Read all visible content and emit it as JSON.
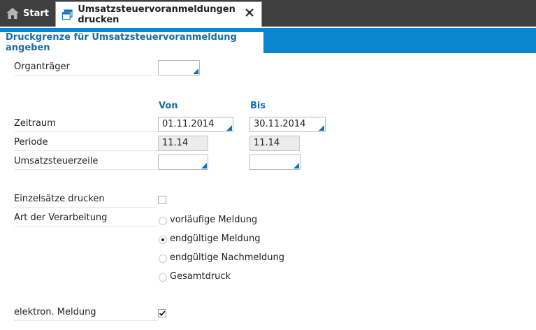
{
  "tabs": {
    "start_label": "Start",
    "active_label": "Umsatzsteuervoranmeldungen drucken"
  },
  "section": {
    "title": "Druckgrenze für Umsatzsteuervoranmeldung angeben"
  },
  "columns": {
    "from": "Von",
    "to": "Bis"
  },
  "fields": {
    "organtraeger": {
      "label": "Organträger",
      "value": ""
    },
    "zeitraum": {
      "label": "Zeitraum",
      "from": "01.11.2014",
      "to": "30.11.2014"
    },
    "periode": {
      "label": "Periode",
      "from": "11.14",
      "to": "11.14"
    },
    "umsatzsteuerzeile": {
      "label": "Umsatzsteuerzeile",
      "from": "",
      "to": ""
    },
    "einzelsaetze": {
      "label": "Einzelsätze drucken",
      "checked": false
    },
    "verarbeitung": {
      "label": "Art der Verarbeitung",
      "options": [
        "vorläufige Meldung",
        "endgültige Meldung",
        "endgültige Nachmeldung",
        "Gesamtdruck"
      ],
      "selected": "endgültige Meldung"
    },
    "elektron": {
      "label": "elektron. Meldung",
      "checked": true
    }
  },
  "colors": {
    "accent": "#0a86cf",
    "heading": "#1a6ca8",
    "tabbar": "#3f3f3f"
  }
}
